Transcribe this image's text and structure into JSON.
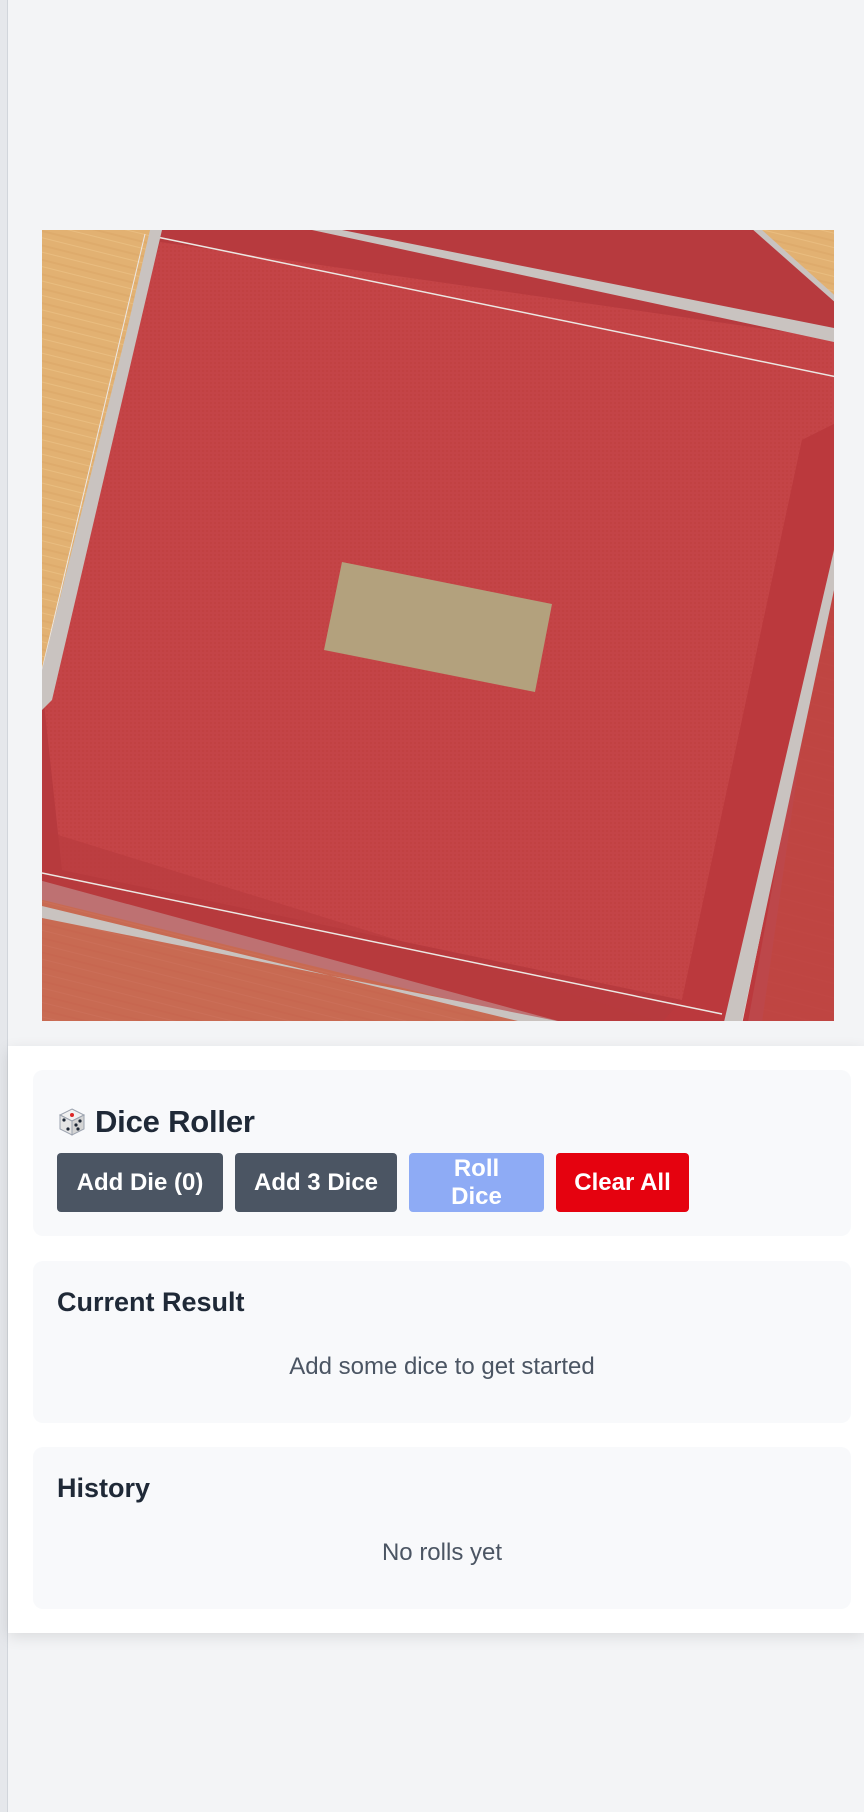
{
  "app": {
    "title": "Dice Roller",
    "icon": "dice-icon"
  },
  "controls": {
    "add_die_label": "Add Die (0)",
    "add_three_label": "Add 3 Dice",
    "roll_label": "Roll Dice",
    "clear_label": "Clear All"
  },
  "result": {
    "heading": "Current Result",
    "empty_message": "Add some dice to get started"
  },
  "history": {
    "heading": "History",
    "empty_message": "No rolls yet"
  },
  "colors": {
    "felt": "#c44447",
    "wood": "#e2b172",
    "rail": "#c9c3c0",
    "button_dark": "#4b5563",
    "button_roll_disabled": "#8eabf5",
    "button_clear": "#e5020f"
  }
}
